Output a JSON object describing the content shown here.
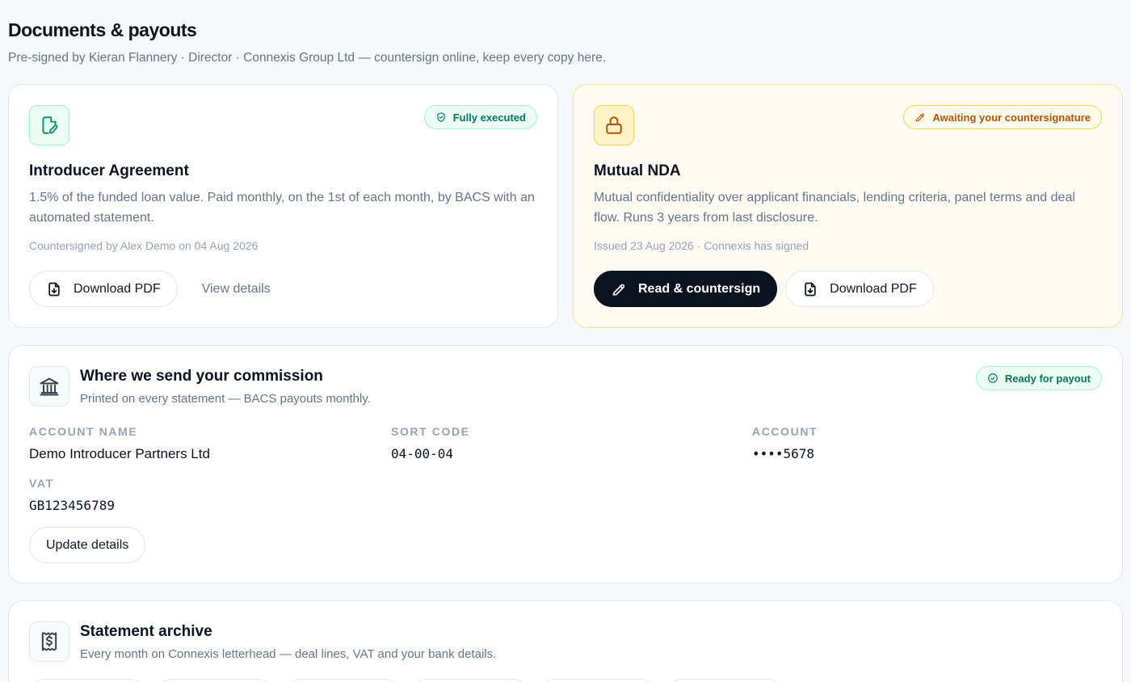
{
  "header": {
    "title": "Documents & payouts",
    "subtitle": "Pre-signed by Kieran Flannery · Director · Connexis Group Ltd — countersign online, keep every copy here."
  },
  "documents": [
    {
      "icon": "document-sign-icon",
      "badge_icon": "shield-check-icon",
      "badge": "Fully executed",
      "title": "Introducer Agreement",
      "description": "1.5% of the funded loan value. Paid monthly, on the 1st of each month, by BACS with an automated statement.",
      "meta": "Countersigned by Alex Demo on 04 Aug 2026",
      "primary_action": "Download PDF",
      "secondary_action": "View details"
    },
    {
      "icon": "lock-icon",
      "badge_icon": "pencil-icon",
      "badge": "Awaiting your countersignature",
      "title": "Mutual NDA",
      "description": "Mutual confidentiality over applicant financials, lending criteria, panel terms and deal flow. Runs 3 years from last disclosure.",
      "meta": "Issued 23 Aug 2026 · Connexis has signed",
      "primary_action": "Read & countersign",
      "secondary_action": "Download PDF"
    }
  ],
  "payout": {
    "icon": "bank-icon",
    "title": "Where we send your commission",
    "subtitle": "Printed on every statement — BACS payouts monthly.",
    "badge": "Ready for payout",
    "fields": {
      "account_name_label": "ACCOUNT NAME",
      "account_name": "Demo Introducer Partners Ltd",
      "sort_code_label": "SORT CODE",
      "sort_code": "04-00-04",
      "account_label": "ACCOUNT",
      "account": "••••5678",
      "vat_label": "VAT",
      "vat": "GB123456789"
    },
    "update_button": "Update details"
  },
  "archive": {
    "icon": "receipt-icon",
    "title": "Statement archive",
    "subtitle": "Every month on Connexis letterhead — deal lines, VAT and your bank details."
  },
  "colors": {
    "success": "#047857",
    "warning": "#b45309",
    "primary_dark": "#0b1220"
  }
}
